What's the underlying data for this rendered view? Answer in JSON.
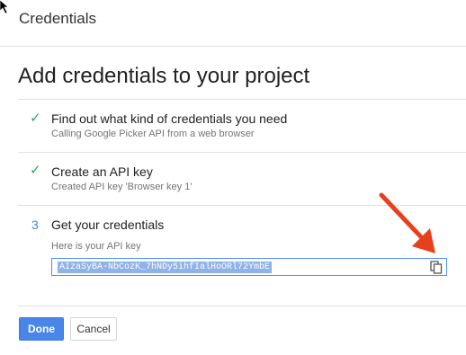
{
  "header": {
    "title": "Credentials"
  },
  "main": {
    "heading": "Add credentials to your project",
    "steps": [
      {
        "marker": "✓",
        "title": "Find out what kind of credentials you need",
        "subtitle": "Calling Google Picker API from a web browser"
      },
      {
        "marker": "✓",
        "title": "Create an API key",
        "subtitle": "Created API key 'Browser key 1'"
      },
      {
        "marker": "3",
        "title": "Get your credentials",
        "subtitle": "Here is your API key"
      }
    ],
    "api_key": "AIzaSyBA-NbCozK_7hNDy5ihfIalHoORl72YmbE"
  },
  "actions": {
    "done_label": "Done",
    "cancel_label": "Cancel"
  },
  "colors": {
    "accent": "#4a86e8",
    "check": "#34a853",
    "arrow": "#e8401c"
  },
  "icons": {
    "copy": "copy-icon",
    "cursor": "cursor-icon",
    "annotation": "red-arrow"
  }
}
